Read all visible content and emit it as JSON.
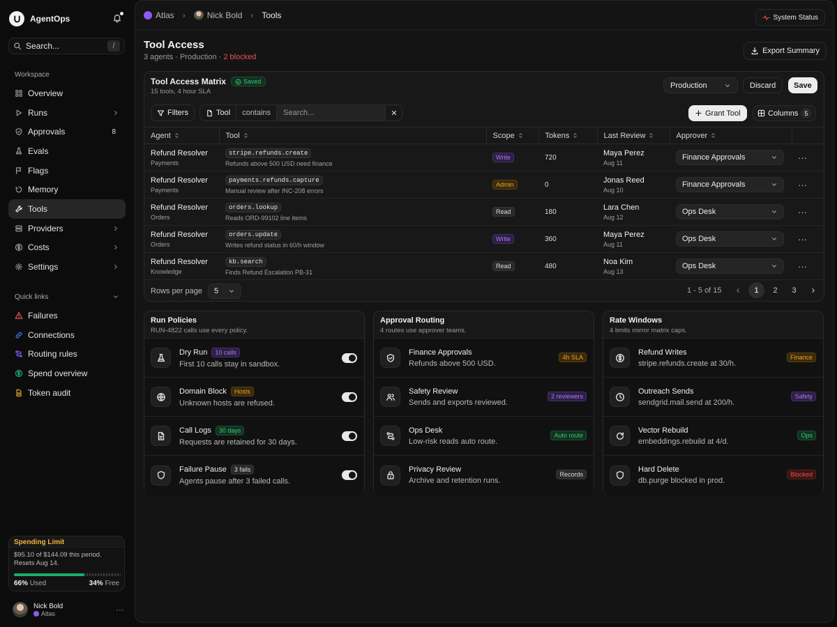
{
  "app": {
    "name": "AgentOps"
  },
  "sidebar": {
    "search_placeholder": "Search...",
    "search_kbd": "/",
    "workspace_heading": "Workspace",
    "items": [
      {
        "label": "Overview",
        "icon": "grid-icon"
      },
      {
        "label": "Runs",
        "icon": "play-icon",
        "chevron": true
      },
      {
        "label": "Approvals",
        "icon": "shield-check-icon",
        "count": "8"
      },
      {
        "label": "Evals",
        "icon": "flask-icon"
      },
      {
        "label": "Flags",
        "icon": "flag-icon"
      },
      {
        "label": "Memory",
        "icon": "memory-icon"
      },
      {
        "label": "Tools",
        "icon": "wrench-icon",
        "active": true
      },
      {
        "label": "Providers",
        "icon": "server-icon",
        "chevron": true
      },
      {
        "label": "Costs",
        "icon": "dollar-icon",
        "chevron": true
      },
      {
        "label": "Settings",
        "icon": "gear-icon",
        "chevron": true
      }
    ],
    "quick_heading": "Quick links",
    "quick_links": [
      {
        "label": "Failures",
        "icon": "warning-icon",
        "color": "#e5534b"
      },
      {
        "label": "Connections",
        "icon": "link-icon",
        "color": "#3b82f6"
      },
      {
        "label": "Routing rules",
        "icon": "route-icon",
        "color": "#8a5cf5"
      },
      {
        "label": "Spend overview",
        "icon": "dollar-icon",
        "color": "#16b06d"
      },
      {
        "label": "Token audit",
        "icon": "document-icon",
        "color": "#e6a529"
      }
    ],
    "spending": {
      "title": "Spending Limit",
      "text": "$95.10 of $144.09 this period. Resets Aug 14.",
      "used_pct": 66,
      "used_value": "66%",
      "used_label": "Used",
      "free_value": "34%",
      "free_label": "Free"
    },
    "user": {
      "name": "Nick Bold",
      "org": "Atlas"
    }
  },
  "topbar": {
    "breadcrumbs": [
      "Atlas",
      "Nick Bold",
      "Tools"
    ],
    "status_label": "System Status"
  },
  "page": {
    "title": "Tool Access",
    "sub_agents": "3 agents",
    "sub_env": "Production",
    "sub_blocked": "2 blocked",
    "export_label": "Export Summary"
  },
  "matrix": {
    "title": "Tool Access Matrix",
    "saved_label": "Saved",
    "subtitle": "15 tools, 4 hour SLA",
    "env_value": "Production",
    "discard_label": "Discard",
    "save_label": "Save",
    "filters_label": "Filters",
    "filter_field": "Tool",
    "filter_op": "contains",
    "filter_placeholder": "Search...",
    "grant_label": "Grant Tool",
    "columns_label": "Columns",
    "columns_count": "5",
    "headers": [
      "Agent",
      "Tool",
      "Scope",
      "Tokens",
      "Last Review",
      "Approver"
    ],
    "rows": [
      {
        "agent": "Refund Resolver",
        "agent_sub": "Payments",
        "tool": "stripe.refunds.create",
        "tool_sub": "Refunds above 500 USD need finance",
        "scope": "Write",
        "tokens": "720",
        "reviewer": "Maya Perez",
        "review_date": "Aug 11",
        "approver": "Finance Approvals"
      },
      {
        "agent": "Refund Resolver",
        "agent_sub": "Payments",
        "tool": "payments.refunds.capture",
        "tool_sub": "Manual review after INC-208 errors",
        "scope": "Admin",
        "tokens": "0",
        "reviewer": "Jonas Reed",
        "review_date": "Aug 10",
        "approver": "Finance Approvals"
      },
      {
        "agent": "Refund Resolver",
        "agent_sub": "Orders",
        "tool": "orders.lookup",
        "tool_sub": "Reads ORD-99102 line items",
        "scope": "Read",
        "tokens": "180",
        "reviewer": "Lara Chen",
        "review_date": "Aug 12",
        "approver": "Ops Desk"
      },
      {
        "agent": "Refund Resolver",
        "agent_sub": "Orders",
        "tool": "orders.update",
        "tool_sub": "Writes refund status in 60/h window",
        "scope": "Write",
        "tokens": "360",
        "reviewer": "Maya Perez",
        "review_date": "Aug 11",
        "approver": "Ops Desk"
      },
      {
        "agent": "Refund Resolver",
        "agent_sub": "Knowledge",
        "tool": "kb.search",
        "tool_sub": "Finds Refund Escalation PB-31",
        "scope": "Read",
        "tokens": "480",
        "reviewer": "Noa Kim",
        "review_date": "Aug 13",
        "approver": "Ops Desk"
      }
    ],
    "rows_per_page_label": "Rows per page",
    "rows_per_page": "5",
    "range": "1 - 5 of 15",
    "pages": [
      "1",
      "2",
      "3"
    ],
    "current_page": "1"
  },
  "policies": {
    "title": "Run Policies",
    "subtitle": "RUN-4822 calls use every policy.",
    "items": [
      {
        "name": "Dry Run",
        "badge": "10 calls",
        "badge_style": "purple",
        "desc": "First 10 calls stay in sandbox.",
        "icon": "flask-icon",
        "enabled": true
      },
      {
        "name": "Domain Block",
        "badge": "Hosts",
        "badge_style": "gold",
        "desc": "Unknown hosts are refused.",
        "icon": "globe-block-icon",
        "enabled": true
      },
      {
        "name": "Call Logs",
        "badge": "30 days",
        "badge_style": "green",
        "desc": "Requests are retained for 30 days.",
        "icon": "file-log-icon",
        "enabled": true
      },
      {
        "name": "Failure Pause",
        "badge": "3 fails",
        "badge_style": "gray",
        "desc": "Agents pause after 3 failed calls.",
        "icon": "shield-icon",
        "enabled": true
      }
    ]
  },
  "routing": {
    "title": "Approval Routing",
    "subtitle": "4 routes use approver teams.",
    "items": [
      {
        "name": "Finance Approvals",
        "desc": "Refunds above 500 USD.",
        "badge": "4h SLA",
        "badge_style": "gold",
        "icon": "shield-check-icon"
      },
      {
        "name": "Safety Review",
        "desc": "Sends and exports reviewed.",
        "badge": "2 reviewers",
        "badge_style": "purple",
        "icon": "users-icon"
      },
      {
        "name": "Ops Desk",
        "desc": "Low-risk reads auto route.",
        "badge": "Auto route",
        "badge_style": "green",
        "icon": "route-icon"
      },
      {
        "name": "Privacy Review",
        "desc": "Archive and retention runs.",
        "badge": "Records",
        "badge_style": "gray",
        "icon": "lock-icon"
      }
    ]
  },
  "rates": {
    "title": "Rate Windows",
    "subtitle": "4 limits mirror matrix caps.",
    "items": [
      {
        "name": "Refund Writes",
        "desc": "stripe.refunds.create at 30/h.",
        "badge": "Finance",
        "badge_style": "gold",
        "icon": "dollar-icon"
      },
      {
        "name": "Outreach Sends",
        "desc": "sendgrid.mail.send at 200/h.",
        "badge": "Safety",
        "badge_style": "purple",
        "icon": "clock-icon"
      },
      {
        "name": "Vector Rebuild",
        "desc": "embeddings.rebuild at 4/d.",
        "badge": "Ops",
        "badge_style": "green",
        "icon": "refresh-icon"
      },
      {
        "name": "Hard Delete",
        "desc": "db.purge blocked in prod.",
        "badge": "Blocked",
        "badge_style": "red",
        "icon": "shield-icon"
      }
    ]
  }
}
